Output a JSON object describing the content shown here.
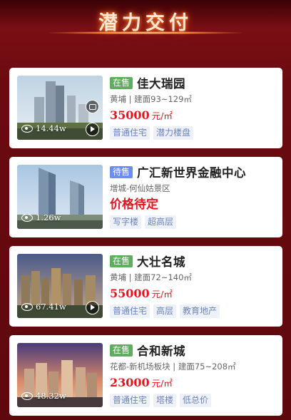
{
  "header": {
    "title": "潜力交付"
  },
  "listings": [
    {
      "status": "在售",
      "status_color": "#5fae5f",
      "name": "佳大瑞园",
      "location": "黄埔 | 建面93~129㎡",
      "price": "35000",
      "price_unit": "元/㎡",
      "views": "14.44w",
      "tags": [
        "普通住宅",
        "潜力楼盘"
      ],
      "has_vr": true,
      "has_video": true
    },
    {
      "status": "待售",
      "status_color": "#6b8cf0",
      "name": "广汇新世界金融中心",
      "location": "增城-何仙姑景区",
      "price": "价格待定",
      "price_unit": "",
      "views": "1.26w",
      "tags": [
        "写字楼",
        "超高层"
      ],
      "has_vr": false,
      "has_video": false
    },
    {
      "status": "在售",
      "status_color": "#5fae5f",
      "name": "大壮名城",
      "location": "黄埔 | 建面72~140㎡",
      "price": "55000",
      "price_unit": "元/㎡",
      "views": "67.41w",
      "tags": [
        "普通住宅",
        "高层",
        "教育地产"
      ],
      "has_vr": false,
      "has_video": true
    },
    {
      "status": "在售",
      "status_color": "#5fae5f",
      "name": "合和新城",
      "location": "花都-新机场板块 | 建面75~208㎡",
      "price": "23000",
      "price_unit": "元/㎡",
      "views": "48.32w",
      "tags": [
        "普通住宅",
        "塔楼",
        "低总价"
      ],
      "has_vr": false,
      "has_video": false
    }
  ]
}
